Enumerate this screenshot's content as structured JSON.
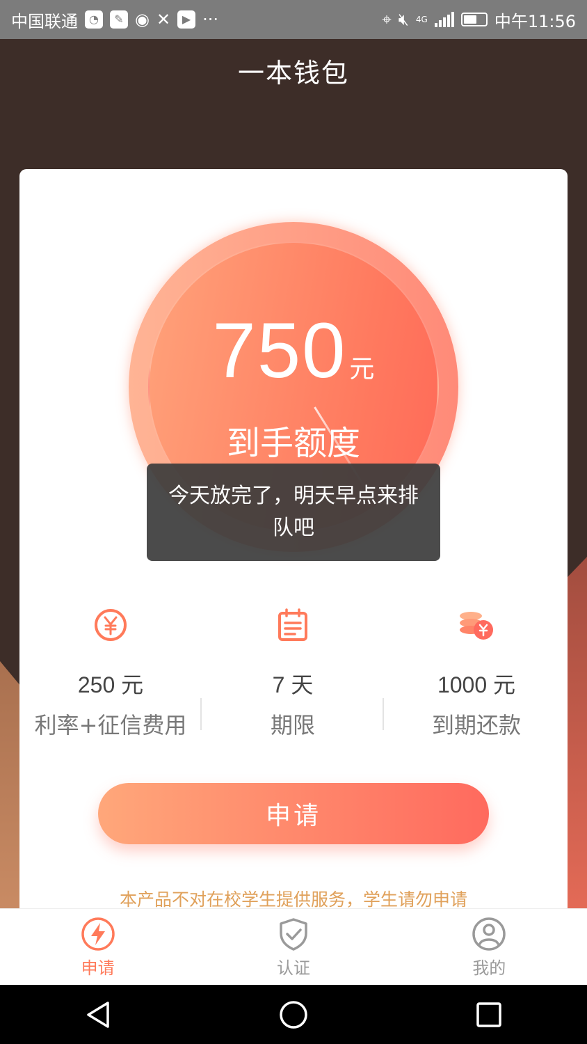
{
  "status_bar": {
    "carrier": "中国联通",
    "time": "中午11:56",
    "network": "4G",
    "more": "···"
  },
  "header": {
    "title": "一本钱包"
  },
  "dial": {
    "amount": "750",
    "unit": "元",
    "label": "到手额度"
  },
  "toast": {
    "message": "今天放完了，明天早点来排队吧"
  },
  "stats": [
    {
      "value": "250 元",
      "label": "利率+征信费用",
      "icon": "yuan-coin-icon"
    },
    {
      "value": "7 天",
      "label": "期限",
      "icon": "calendar-icon"
    },
    {
      "value": "1000 元",
      "label": "到期还款",
      "icon": "coins-stack-icon"
    }
  ],
  "apply_button": {
    "label": "申请"
  },
  "notice": {
    "text": "本产品不对在校学生提供服务，学生请勿申请"
  },
  "tabbar": {
    "items": [
      {
        "label": "申请",
        "icon": "lightning-icon",
        "active": true
      },
      {
        "label": "认证",
        "icon": "shield-check-icon",
        "active": false
      },
      {
        "label": "我的",
        "icon": "user-icon",
        "active": false
      }
    ]
  },
  "colors": {
    "accent": "#ff7a5a",
    "header_bg": "#3d2d28",
    "notice": "#e0a15b"
  }
}
